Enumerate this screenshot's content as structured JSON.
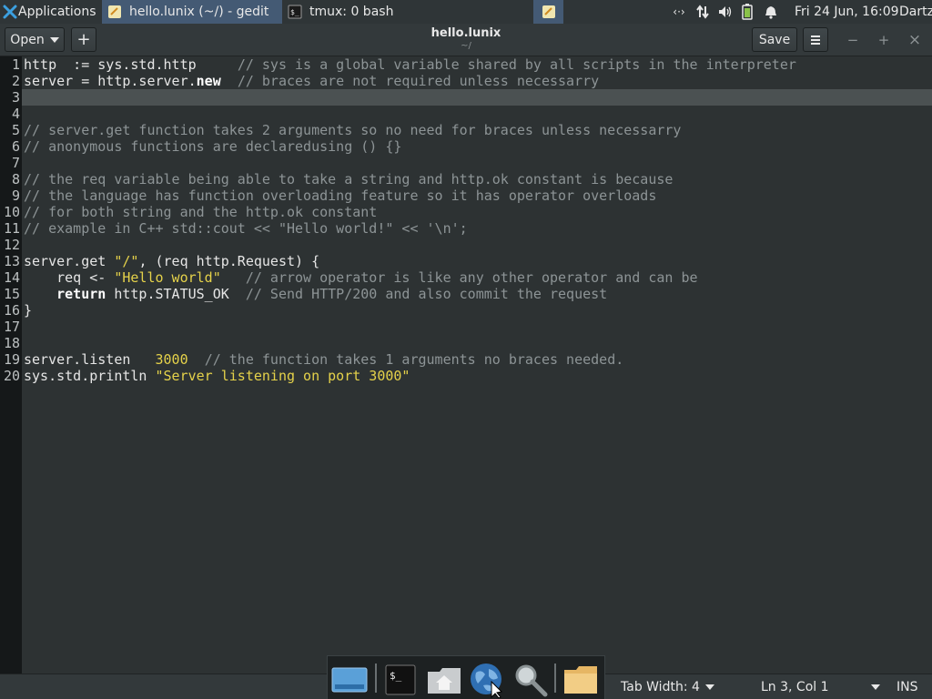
{
  "panel": {
    "applications_label": "Applications",
    "tasks": [
      {
        "label": "hello.lunix (~/) - gedit",
        "icon": "text-editor-icon",
        "active": true
      },
      {
        "label": "tmux: 0 bash",
        "icon": "terminal-icon",
        "active": false
      }
    ],
    "tray_icons": [
      "network-arrows-icon",
      "transfer-icon",
      "volume-icon",
      "battery-icon",
      "notification-bell-icon"
    ],
    "clock": "Fri 24 Jun, 16:09",
    "user": "Dartz"
  },
  "headerbar": {
    "open_label": "Open",
    "new_tab_label": "+",
    "title": "hello.lunix",
    "subtitle": "~/",
    "save_label": "Save",
    "menu_icon": "hamburger-menu-icon",
    "minimize_label": "−",
    "maximize_label": "+",
    "close_label": "×"
  },
  "editor": {
    "current_line": 3,
    "lines": [
      {
        "n": "1",
        "tokens": [
          [
            "plain",
            "http  := sys.std.http     "
          ],
          [
            "comment",
            "// sys is a global variable shared by all scripts in the interpreter"
          ]
        ]
      },
      {
        "n": "2",
        "tokens": [
          [
            "plain",
            "server = http.server."
          ],
          [
            "keyword",
            "new"
          ],
          [
            "plain",
            "  "
          ],
          [
            "comment",
            "// braces are not required unless necessarry"
          ]
        ]
      },
      {
        "n": "3",
        "tokens": []
      },
      {
        "n": "4",
        "tokens": []
      },
      {
        "n": "5",
        "tokens": [
          [
            "comment",
            "// server.get function takes 2 arguments so no need for braces unless necessarry"
          ]
        ]
      },
      {
        "n": "6",
        "tokens": [
          [
            "comment",
            "// anonymous functions are declaredusing () {}"
          ]
        ]
      },
      {
        "n": "7",
        "tokens": []
      },
      {
        "n": "8",
        "tokens": [
          [
            "comment",
            "// the req variable being able to take a string and http.ok constant is because"
          ]
        ]
      },
      {
        "n": "9",
        "tokens": [
          [
            "comment",
            "// the language has function overloading feature so it has operator overloads"
          ]
        ]
      },
      {
        "n": "10",
        "tokens": [
          [
            "comment",
            "// for both string and the http.ok constant"
          ]
        ]
      },
      {
        "n": "11",
        "tokens": [
          [
            "comment",
            "// example in C++ std::cout << \"Hello world!\" << '\\n';"
          ]
        ]
      },
      {
        "n": "12",
        "tokens": []
      },
      {
        "n": "13",
        "tokens": [
          [
            "plain",
            "server.get "
          ],
          [
            "string",
            "\"/\""
          ],
          [
            "plain",
            ", (req http.Request) {"
          ]
        ]
      },
      {
        "n": "14",
        "tokens": [
          [
            "plain",
            "    req <- "
          ],
          [
            "string",
            "\"Hello world\""
          ],
          [
            "plain",
            "   "
          ],
          [
            "comment",
            "// arrow operator is like any other operator and can be"
          ]
        ]
      },
      {
        "n": "15",
        "tokens": [
          [
            "plain",
            "    "
          ],
          [
            "keyword",
            "return"
          ],
          [
            "plain",
            " http.STATUS_OK  "
          ],
          [
            "comment",
            "// Send HTTP/200 and also commit the request"
          ]
        ]
      },
      {
        "n": "16",
        "tokens": [
          [
            "plain",
            "}"
          ]
        ]
      },
      {
        "n": "17",
        "tokens": []
      },
      {
        "n": "18",
        "tokens": []
      },
      {
        "n": "19",
        "tokens": [
          [
            "plain",
            "server.listen   "
          ],
          [
            "number",
            "3000"
          ],
          [
            "plain",
            "  "
          ],
          [
            "comment",
            "// the function takes 1 arguments no braces needed."
          ]
        ]
      },
      {
        "n": "20",
        "tokens": [
          [
            "plain",
            "sys.std.println "
          ],
          [
            "string",
            "\"Server listening on port 3000\""
          ]
        ]
      }
    ]
  },
  "statusbar": {
    "tab_width": "Tab Width: 4",
    "position": "Ln 3, Col 1",
    "mode": "INS"
  },
  "dock": {
    "items": [
      "show-desktop-icon",
      "terminal-icon",
      "home-folder-icon",
      "web-browser-icon",
      "search-icon",
      "file-manager-icon"
    ]
  }
}
